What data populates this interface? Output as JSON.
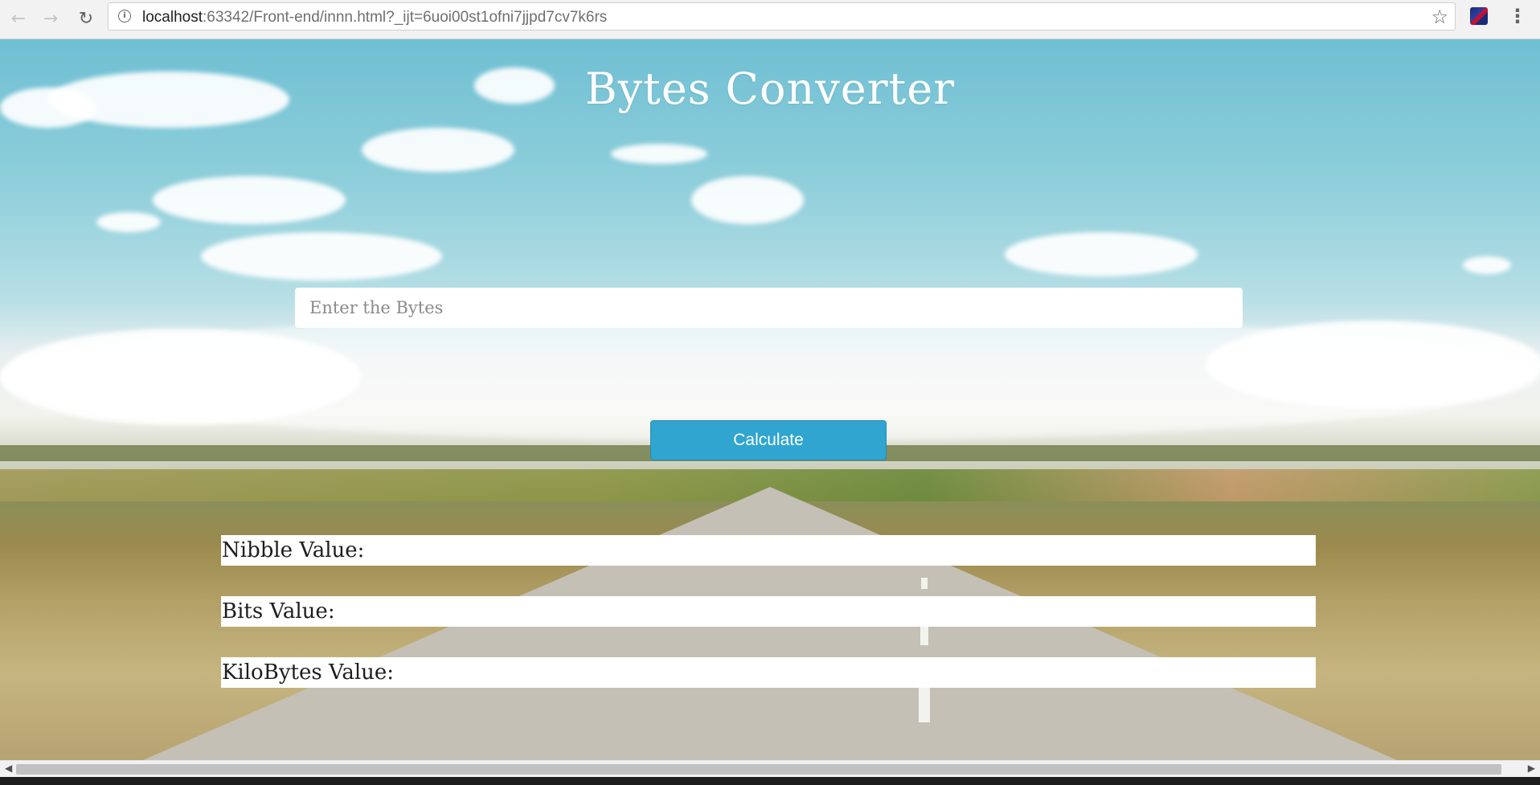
{
  "browser": {
    "url_host": "localhost",
    "url_path": ":63342/Front-end/innn.html?_ijt=6uoi00st1ofni7jjpd7cv7k6rs",
    "back_icon": "back-arrow-icon",
    "forward_icon": "forward-arrow-icon",
    "reload_icon": "reload-icon",
    "info_icon": "info-icon",
    "bookmark_icon": "star-icon",
    "menu_icon": "menu-icon"
  },
  "page": {
    "title": "Bytes Converter",
    "input": {
      "placeholder": "Enter the Bytes",
      "value": ""
    },
    "calculate_label": "Calculate",
    "results": [
      {
        "label": "Nibble Value:"
      },
      {
        "label": "Bits Value:"
      },
      {
        "label": "KiloBytes Value:"
      }
    ]
  },
  "colors": {
    "button": "#2fa5cf",
    "title_text": "#ffffff",
    "result_text": "#1e1e1e"
  }
}
